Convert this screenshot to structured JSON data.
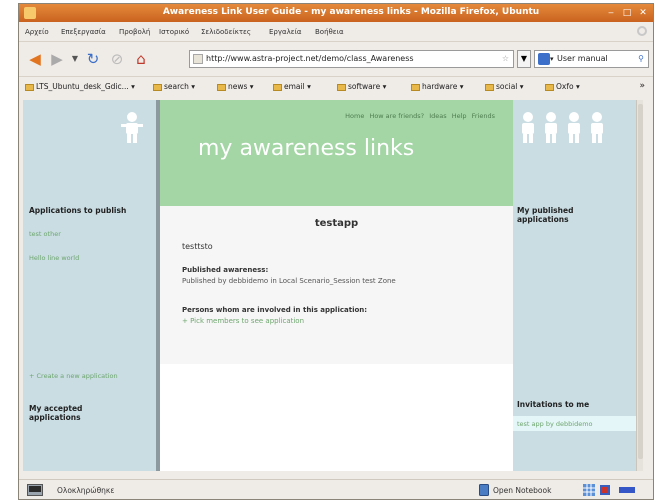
{
  "window": {
    "title": "Awareness Link User Guide - my awareness links - Mozilla Firefox, Ubuntu"
  },
  "menu": [
    "Αρχείο",
    "Επεξεργασία",
    "Προβολή",
    "Ιστορικό",
    "Σελιδοδείκτες",
    "Εργαλεία",
    "Βοήθεια"
  ],
  "toolbar": {
    "url": "http://www.astra-project.net/demo/class_Awareness",
    "search_placeholder": "User manual"
  },
  "bookmarks": [
    "LTS_Ubuntu_desk_Gdic...",
    "search",
    "news",
    "email",
    "software",
    "hardware",
    "social",
    "Oxfo"
  ],
  "page": {
    "top_links": [
      "Home",
      "How are friends?",
      "Ideas",
      "Help",
      "Friends"
    ],
    "site_title": "my awareness links",
    "app_title": "testapp",
    "app_name": "testtsto",
    "published_label": "Published awareness:",
    "published_text": "Published by debbidemo in Local Scenario_Session test Zone",
    "members_label": "Persons whom are involved in this application:",
    "members_link": "+ Pick members to see application"
  },
  "left": {
    "apps_title": "Applications to publish",
    "links": [
      "test other",
      "Hello line world"
    ],
    "create_link": "+ Create a new application",
    "accepted_title": "My accepted applications"
  },
  "right": {
    "published_title": "My published applications",
    "invitations_title": "Invitations to me",
    "invite_link": "test app by debbidemo"
  },
  "status": {
    "text": "Ολοκληρώθηκε",
    "right_text": "Open Notebook"
  }
}
